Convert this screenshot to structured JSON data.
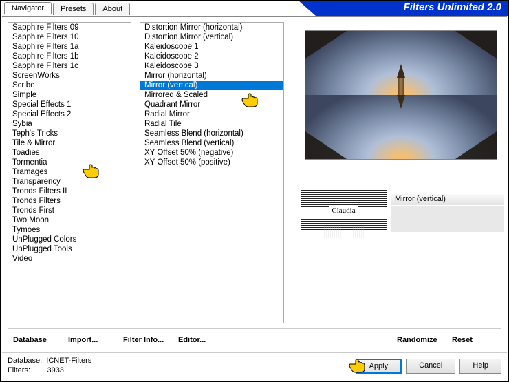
{
  "title": "Filters Unlimited 2.0",
  "tabs": [
    {
      "label": "Navigator",
      "active": true
    },
    {
      "label": "Presets",
      "active": false
    },
    {
      "label": "About",
      "active": false
    }
  ],
  "categories": [
    "Sapphire Filters 09",
    "Sapphire Filters 10",
    "Sapphire Filters 1a",
    "Sapphire Filters 1b",
    "Sapphire Filters 1c",
    "ScreenWorks",
    "Scribe",
    "Simple",
    "Special Effects 1",
    "Special Effects 2",
    "Sybia",
    "Teph's Tricks",
    "Tile & Mirror",
    "Toadies",
    "Tormentia",
    "Tramages",
    "Transparency",
    "Tronds Filters II",
    "Tronds Filters",
    "Tronds First",
    "Two Moon",
    "Tymoes",
    "UnPlugged Colors",
    "UnPlugged Tools",
    "Video"
  ],
  "category_selected": "Tile & Mirror",
  "filters": [
    "Distortion Mirror (horizontal)",
    "Distortion Mirror (vertical)",
    "Kaleidoscope 1",
    "Kaleidoscope 2",
    "Kaleidoscope 3",
    "Mirror (horizontal)",
    "Mirror (vertical)",
    "Mirrored & Scaled",
    "Quadrant Mirror",
    "Radial Mirror",
    "Radial Tile",
    "Seamless Blend (horizontal)",
    "Seamless Blend (vertical)",
    "XY Offset 50% (negative)",
    "XY Offset 50% (positive)"
  ],
  "filter_selected": "Mirror (vertical)",
  "watermark_text": "Claudia",
  "param_name": "Mirror (vertical)",
  "bottom_links": {
    "database": "Database",
    "import": "Import...",
    "filter_info": "Filter Info...",
    "editor": "Editor...",
    "randomize": "Randomize",
    "reset": "Reset"
  },
  "footer": {
    "db_label": "Database:",
    "db_name": "ICNET-Filters",
    "filters_label": "Filters:",
    "filters_count": "3933",
    "apply": "Apply",
    "cancel": "Cancel",
    "help": "Help"
  }
}
